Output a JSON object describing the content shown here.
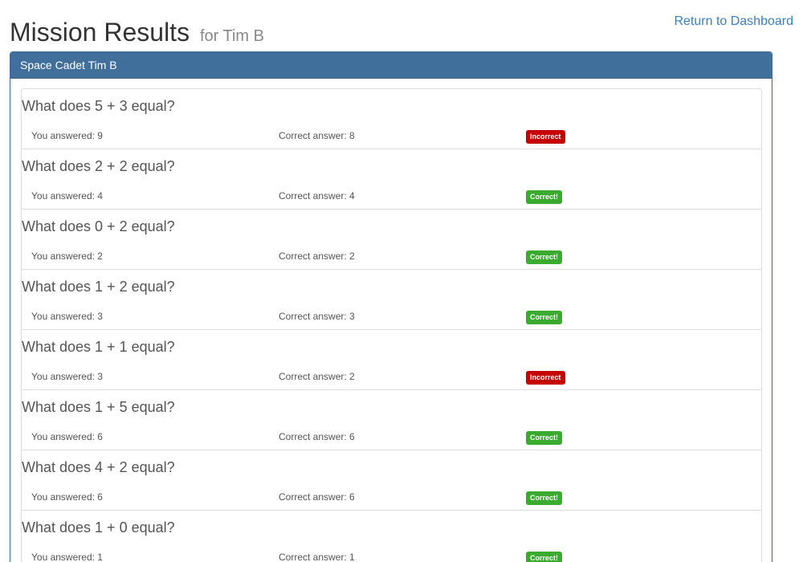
{
  "header": {
    "title": "Mission Results",
    "subtitle": "for Tim B",
    "dashboard_link": "Return to Dashboard"
  },
  "panel": {
    "heading": "Space Cadet Tim B"
  },
  "results": [
    {
      "question": "What does 5 + 3 equal?",
      "answered": "You answered: 9",
      "correct": "Correct answer: 8",
      "status": "Incorrect",
      "ok": false
    },
    {
      "question": "What does 2 + 2 equal?",
      "answered": "You answered: 4",
      "correct": "Correct answer: 4",
      "status": "Correct!",
      "ok": true
    },
    {
      "question": "What does 0 + 2 equal?",
      "answered": "You answered: 2",
      "correct": "Correct answer: 2",
      "status": "Correct!",
      "ok": true
    },
    {
      "question": "What does 1 + 2 equal?",
      "answered": "You answered: 3",
      "correct": "Correct answer: 3",
      "status": "Correct!",
      "ok": true
    },
    {
      "question": "What does 1 + 1 equal?",
      "answered": "You answered: 3",
      "correct": "Correct answer: 2",
      "status": "Incorrect",
      "ok": false
    },
    {
      "question": "What does 1 + 5 equal?",
      "answered": "You answered: 6",
      "correct": "Correct answer: 6",
      "status": "Correct!",
      "ok": true
    },
    {
      "question": "What does 4 + 2 equal?",
      "answered": "You answered: 6",
      "correct": "Correct answer: 6",
      "status": "Correct!",
      "ok": true
    },
    {
      "question": "What does 1 + 0 equal?",
      "answered": "You answered: 1",
      "correct": "Correct answer: 1",
      "status": "Correct!",
      "ok": true
    }
  ],
  "colors": {
    "correct_badge": "#3aab2f",
    "incorrect_badge": "#c60000",
    "panel_heading": "#416f9c",
    "link": "#3a7fc1"
  }
}
